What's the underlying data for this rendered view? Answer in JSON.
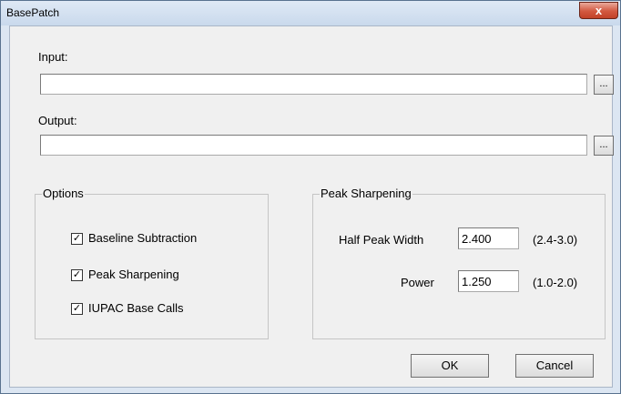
{
  "window": {
    "title": "BasePatch",
    "close_glyph": "x"
  },
  "input": {
    "label": "Input:",
    "value": "",
    "browse_label": "..."
  },
  "output": {
    "label": "Output:",
    "value": "",
    "browse_label": "..."
  },
  "options": {
    "legend": "Options",
    "items": [
      {
        "label": "Baseline Subtraction",
        "checked": true
      },
      {
        "label": "Peak Sharpening",
        "checked": true
      },
      {
        "label": "IUPAC Base Calls",
        "checked": true
      }
    ],
    "check_glyph": "✓"
  },
  "peak": {
    "legend": "Peak Sharpening",
    "half_peak_width": {
      "label": "Half Peak Width",
      "value": "2.400",
      "range": "(2.4-3.0)"
    },
    "power": {
      "label": "Power",
      "value": "1.250",
      "range": "(1.0-2.0)"
    }
  },
  "buttons": {
    "ok_label": "OK",
    "cancel_label": "Cancel"
  }
}
